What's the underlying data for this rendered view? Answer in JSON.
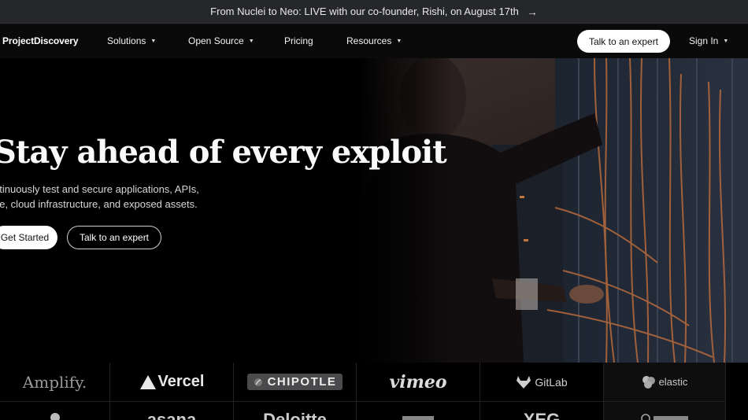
{
  "announcement": {
    "text": "From Nuclei to Neo: LIVE with our co-founder, Rishi, on August 17th",
    "arrow": "→"
  },
  "nav": {
    "logo": "ProjectDiscovery",
    "items": [
      {
        "label": "Solutions",
        "dropdown": true
      },
      {
        "label": "Open Source",
        "dropdown": true
      },
      {
        "label": "Pricing",
        "dropdown": false
      },
      {
        "label": "Resources",
        "dropdown": true
      }
    ],
    "cta": "Talk to an expert",
    "signin": "Sign In"
  },
  "hero": {
    "headline": "Stay ahead of every exploit",
    "sub_line1": "ntinuously test and secure applications, APIs,",
    "sub_line2": "de, cloud infrastructure, and exposed assets.",
    "primary_button": "Get Started",
    "secondary_button": "Talk to an expert"
  },
  "logos": {
    "row1": [
      "Amplify.",
      "Vercel",
      "CHIPOTLE",
      "vimeo",
      "GitLab",
      "elastic"
    ],
    "row2": [
      "asana",
      "Deloitte",
      "XEG"
    ]
  },
  "colors": {
    "accent": "#ffffff",
    "background": "#000000",
    "announcement_bg": "#26272b"
  }
}
